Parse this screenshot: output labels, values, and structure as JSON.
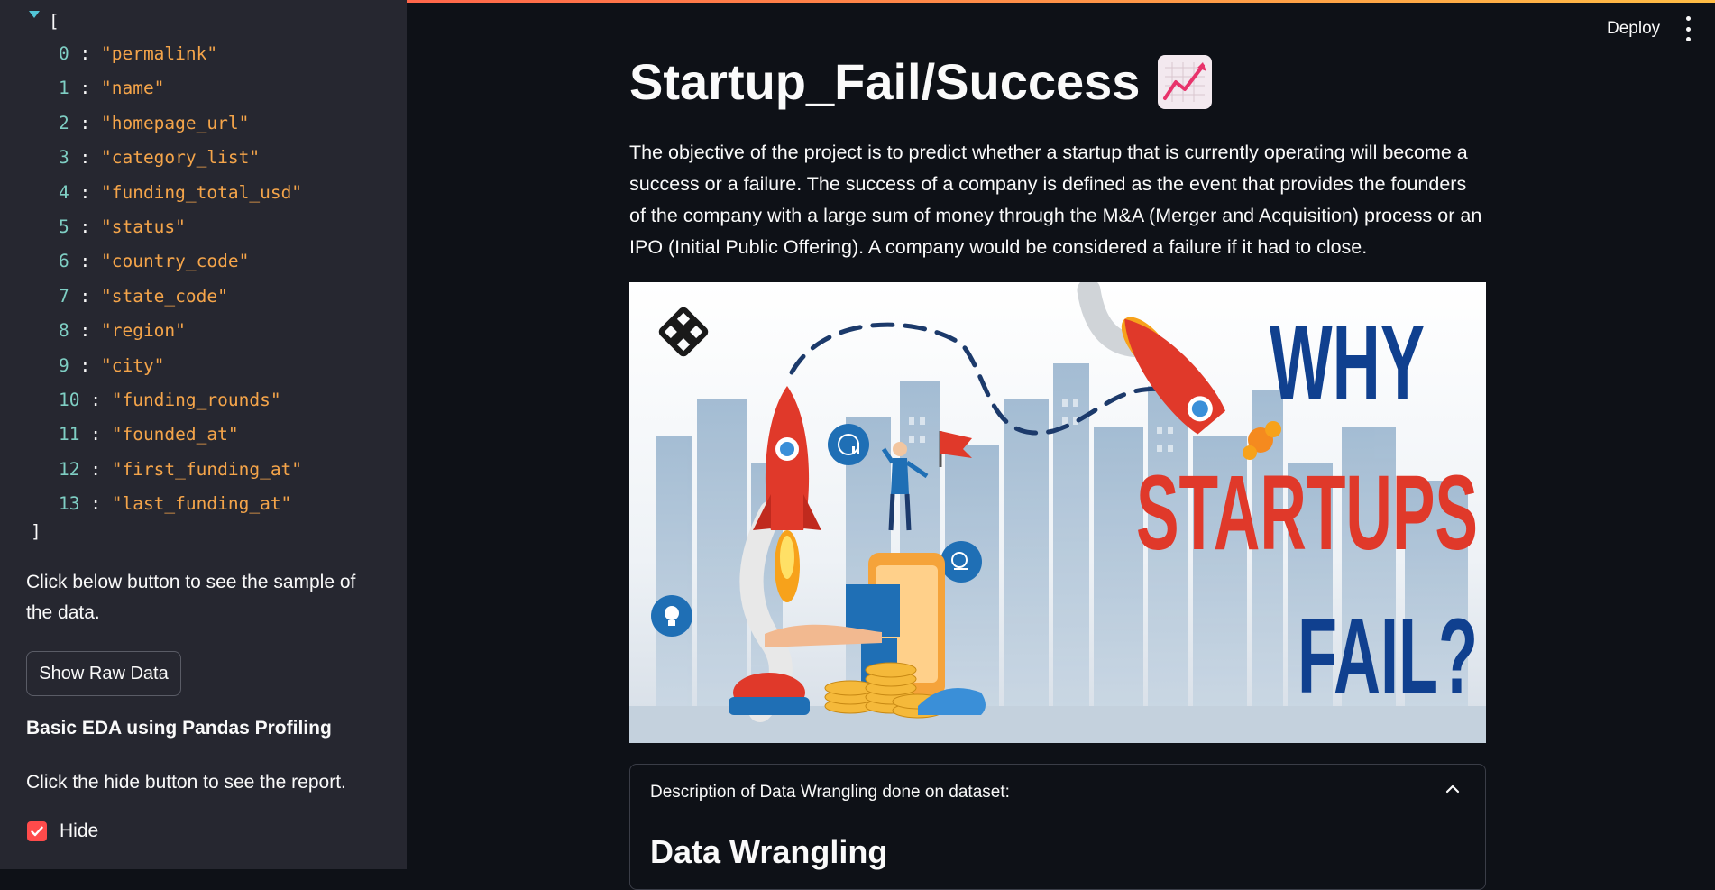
{
  "sidebar": {
    "json_open": "[",
    "json_close": "]",
    "columns": [
      {
        "idx": "0",
        "val": "\"permalink\""
      },
      {
        "idx": "1",
        "val": "\"name\""
      },
      {
        "idx": "2",
        "val": "\"homepage_url\""
      },
      {
        "idx": "3",
        "val": "\"category_list\""
      },
      {
        "idx": "4",
        "val": "\"funding_total_usd\""
      },
      {
        "idx": "5",
        "val": "\"status\""
      },
      {
        "idx": "6",
        "val": "\"country_code\""
      },
      {
        "idx": "7",
        "val": "\"state_code\""
      },
      {
        "idx": "8",
        "val": "\"region\""
      },
      {
        "idx": "9",
        "val": "\"city\""
      },
      {
        "idx": "10",
        "val": "\"funding_rounds\""
      },
      {
        "idx": "11",
        "val": "\"founded_at\""
      },
      {
        "idx": "12",
        "val": "\"first_funding_at\""
      },
      {
        "idx": "13",
        "val": "\"last_funding_at\""
      }
    ],
    "sample_text": "Click below button to see the sample of the data.",
    "show_raw_button": "Show Raw Data",
    "eda_heading": "Basic EDA using Pandas Profiling",
    "report_text": "Click the hide button to see the report.",
    "hide_label": "Hide",
    "hide_checked": true
  },
  "header": {
    "deploy_label": "Deploy"
  },
  "main": {
    "title": "Startup_Fail/Success",
    "title_icon": "chart-increasing-emoji",
    "description": "The objective of the project is to predict whether a startup that is currently operating will become a success or a failure. The success of a company is defined as the event that provides the founders of the company with a large sum of money through the M&A (Merger and Acquisition) process or an IPO (Initial Public Offering). A company would be considered a failure if it had to close.",
    "hero": {
      "line1": "WHY",
      "line2": "STARTUPS",
      "line3": "FAIL?",
      "blue": "#10408f",
      "red": "#e0392a"
    },
    "expander": {
      "label": "Description of Data Wrangling done on dataset:",
      "heading": "Data Wrangling"
    }
  }
}
